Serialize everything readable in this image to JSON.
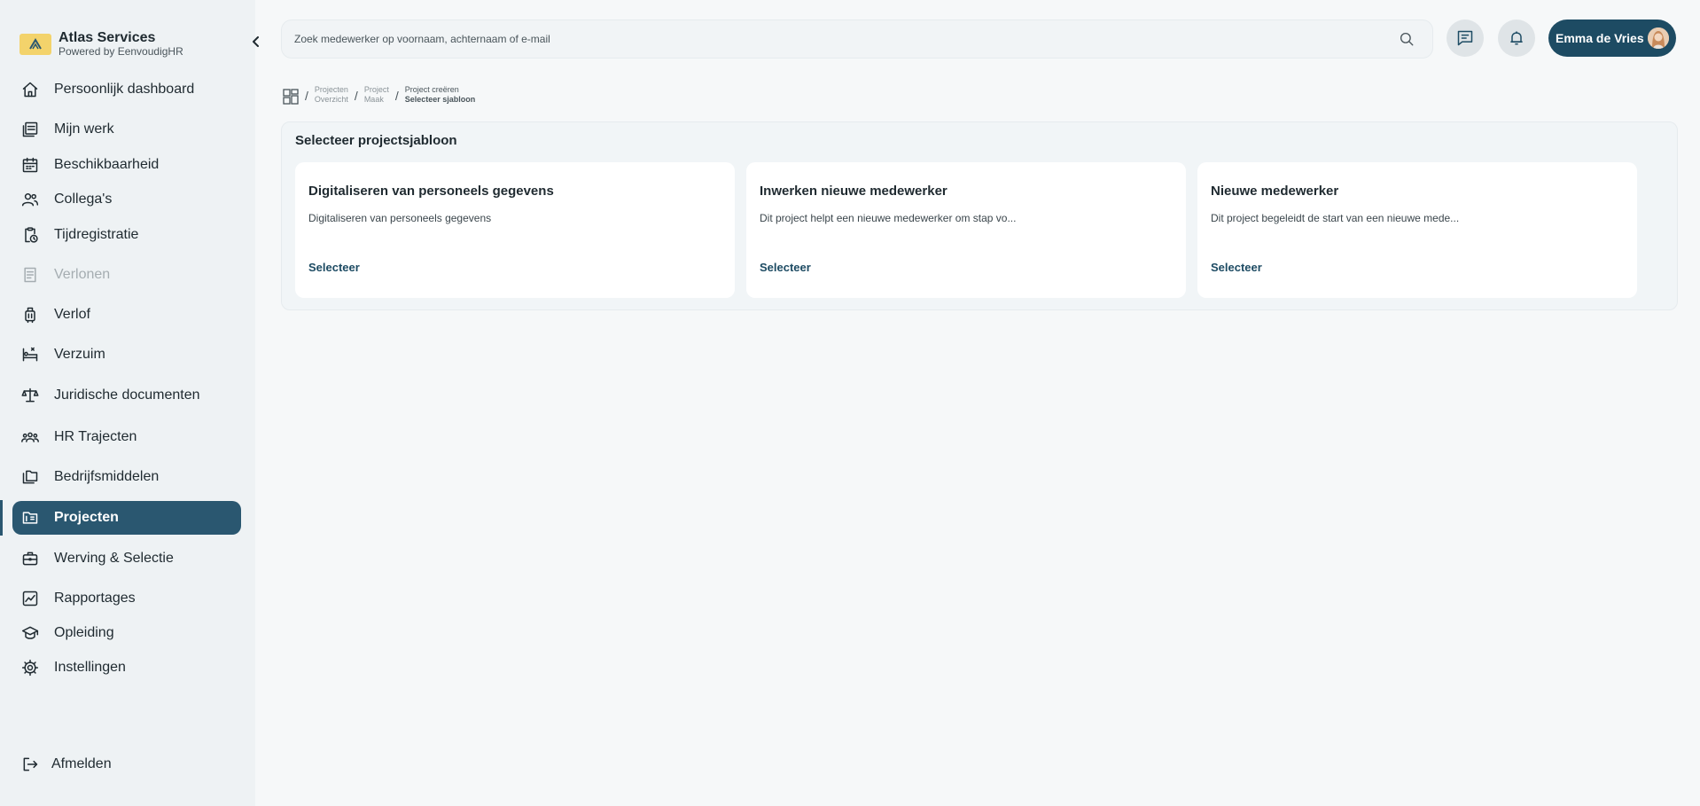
{
  "brand": {
    "title": "Atlas Services",
    "subtitle": "Powered by EenvoudigHR"
  },
  "sidebar": {
    "items": [
      {
        "label": "Persoonlijk dashboard",
        "icon": "home-icon"
      },
      {
        "label": "Mijn werk",
        "icon": "work-list-icon"
      },
      {
        "label": "Beschikbaarheid",
        "icon": "calendar-icon"
      },
      {
        "label": "Collega's",
        "icon": "people-icon"
      },
      {
        "label": "Tijdregistratie",
        "icon": "clipboard-clock-icon"
      },
      {
        "label": "Verlonen",
        "icon": "receipt-icon",
        "disabled": true
      },
      {
        "label": "Verlof",
        "icon": "suitcase-icon"
      },
      {
        "label": "Verzuim",
        "icon": "sick-bed-icon"
      },
      {
        "label": "Juridische documenten",
        "icon": "scale-icon"
      },
      {
        "label": "HR Trajecten",
        "icon": "team-icon"
      },
      {
        "label": "Bedrijfsmiddelen",
        "icon": "assets-icon"
      },
      {
        "label": "Projecten",
        "icon": "project-folder-icon",
        "active": true
      },
      {
        "label": "Werving & Selectie",
        "icon": "briefcase-icon"
      },
      {
        "label": "Rapportages",
        "icon": "chart-icon"
      },
      {
        "label": "Opleiding",
        "icon": "graduation-cap-icon"
      },
      {
        "label": "Instellingen",
        "icon": "gear-icon"
      }
    ],
    "logout": "Afmelden"
  },
  "search": {
    "placeholder": "Zoek medewerker op voornaam, achternaam of e-mail"
  },
  "user": {
    "name": "Emma de Vries"
  },
  "breadcrumb": [
    {
      "line1": "Projecten",
      "line2": "Overzicht"
    },
    {
      "line1": "Project",
      "line2": "Maak"
    },
    {
      "line1": "Project creëren",
      "line2": "Selecteer sjabloon"
    }
  ],
  "main": {
    "title": "Selecteer projectsjabloon",
    "cards": [
      {
        "title": "Digitaliseren van personeels gegevens",
        "description": "Digitaliseren van personeels gegevens",
        "action": "Selecteer"
      },
      {
        "title": "Inwerken nieuwe medewerker",
        "description": "Dit project helpt een nieuwe medewerker om stap vo...",
        "action": "Selecteer"
      },
      {
        "title": "Nieuwe medewerker",
        "description": "Dit project begeleidt de start van een nieuwe mede...",
        "action": "Selecteer"
      }
    ]
  },
  "colors": {
    "accent": "#2a5770",
    "brand_yellow": "#f3d36b",
    "user_button": "#1d4b63"
  }
}
